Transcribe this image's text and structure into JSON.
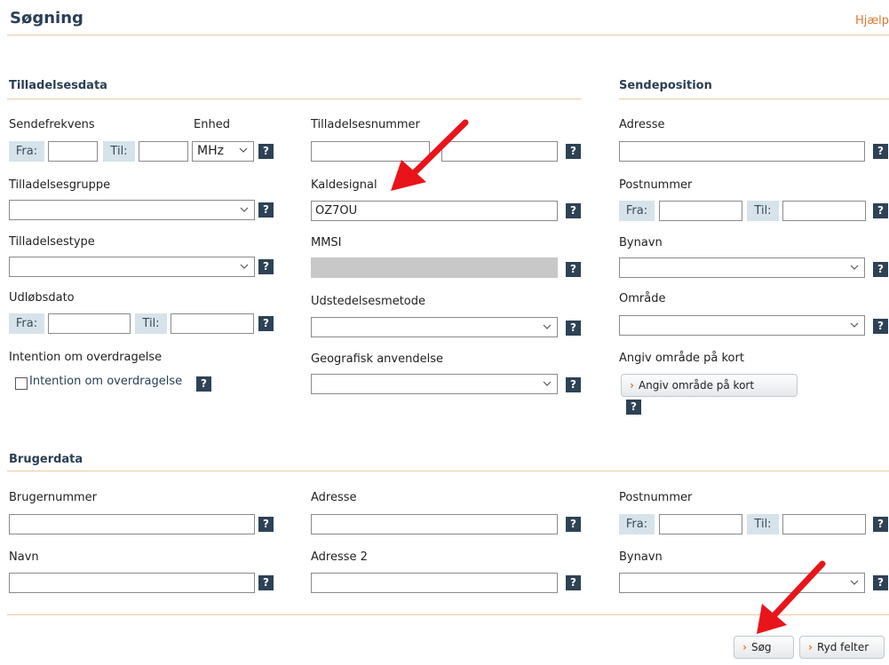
{
  "header": {
    "title": "Søgning",
    "help": "Hjælp"
  },
  "sections": {
    "tilladelsesdata": "Tilladelsesdata",
    "sendeposition": "Sendeposition",
    "brugerdata": "Brugerdata"
  },
  "labels": {
    "sendefrekvens": "Sendefrekvens",
    "enhed": "Enhed",
    "tilladelsesnummer": "Tilladelsesnummer",
    "adresse": "Adresse",
    "tilladelsesgruppe": "Tilladelsesgruppe",
    "kaldesignal": "Kaldesignal",
    "postnummer": "Postnummer",
    "tilladelsestype": "Tilladelsestype",
    "mmsi": "MMSI",
    "bynavn": "Bynavn",
    "udloebsdato": "Udløbsdato",
    "udstedelsesmetode": "Udstedelsesmetode",
    "omraade": "Område",
    "intention": "Intention om overdragelse",
    "geografisk": "Geografisk anvendelse",
    "angiv_omraade": "Angiv område på kort",
    "brugernummer": "Brugernummer",
    "bruger_adresse": "Adresse",
    "bruger_postnummer": "Postnummer",
    "navn": "Navn",
    "adresse2": "Adresse 2",
    "bruger_bynavn": "Bynavn"
  },
  "common": {
    "fra": "Fra:",
    "til": "Til:",
    "help_q": "?"
  },
  "values": {
    "enhed": "MHz",
    "kaldesignal": "OZ7OU",
    "intention_checkbox_label": "Intention om overdragelse"
  },
  "buttons": {
    "angiv_omraade": "Angiv område på kort",
    "soeg": "Søg",
    "ryd": "Ryd felter"
  },
  "icons": {
    "button_arrow": "chevron-right-icon",
    "annotation": "red-arrow-icon"
  },
  "colors": {
    "accent": "#e07a2e",
    "heading": "#2a3e55",
    "help_bg": "#2d4255",
    "pill_bg": "#d6e3ea",
    "arrow": "#e8141a"
  }
}
